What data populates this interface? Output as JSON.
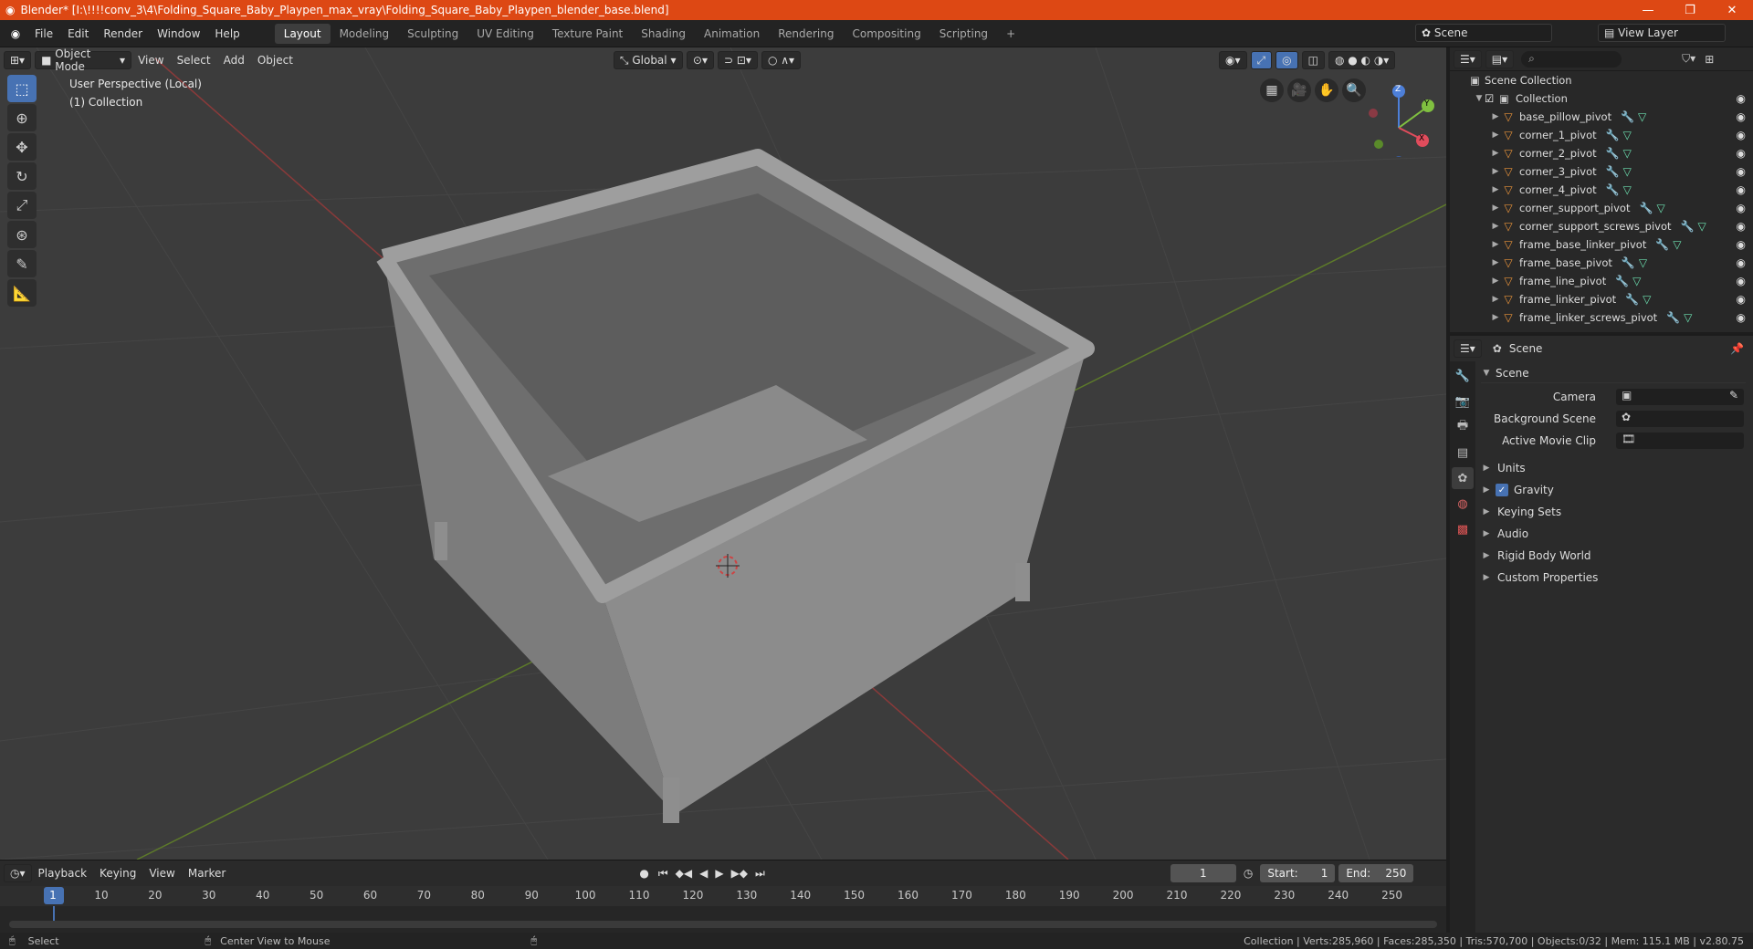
{
  "window": {
    "title": "Blender* [I:\\!!!!conv_3\\4\\Folding_Square_Baby_Playpen_max_vray\\Folding_Square_Baby_Playpen_blender_base.blend]",
    "minimize": "—",
    "maximize": "❐",
    "close": "✕"
  },
  "menu": [
    "File",
    "Edit",
    "Render",
    "Window",
    "Help"
  ],
  "workspaces": [
    "Layout",
    "Modeling",
    "Sculpting",
    "UV Editing",
    "Texture Paint",
    "Shading",
    "Animation",
    "Rendering",
    "Compositing",
    "Scripting"
  ],
  "workspace_add": "+",
  "scene_name": "Scene",
  "view_layer": "View Layer",
  "viewport": {
    "mode": "Object Mode",
    "menus": [
      "View",
      "Select",
      "Add",
      "Object"
    ],
    "orientation": "Global",
    "perspective_label": "User Perspective (Local)",
    "collection_label": "(1) Collection",
    "gizmo": {
      "x": "X",
      "y": "Y",
      "z": "Z"
    }
  },
  "timeline": {
    "menus": [
      "Playback",
      "Keying",
      "View",
      "Marker"
    ],
    "current_frame": "1",
    "start_label": "Start:",
    "start": "1",
    "end_label": "End:",
    "end": "250",
    "ticks": [
      "1",
      "10",
      "20",
      "30",
      "40",
      "50",
      "60",
      "70",
      "80",
      "90",
      "100",
      "110",
      "120",
      "130",
      "140",
      "150",
      "160",
      "170",
      "180",
      "190",
      "200",
      "210",
      "220",
      "230",
      "240",
      "250"
    ]
  },
  "status": {
    "select": "Select",
    "center_view": "Center View to Mouse",
    "stats": "Collection | Verts:285,960 | Faces:285,350 | Tris:570,700 | Objects:0/32 | Mem: 115.1 MB | v2.80.75"
  },
  "outliner": {
    "root": "Scene Collection",
    "collection": "Collection",
    "items": [
      "base_pillow_pivot",
      "corner_1_pivot",
      "corner_2_pivot",
      "corner_3_pivot",
      "corner_4_pivot",
      "corner_support_pivot",
      "corner_support_screws_pivot",
      "frame_base_linker_pivot",
      "frame_base_pivot",
      "frame_line_pivot",
      "frame_linker_pivot",
      "frame_linker_screws_pivot"
    ]
  },
  "properties": {
    "context": "Scene",
    "panel": "Scene",
    "camera_label": "Camera",
    "background_label": "Background Scene",
    "movieclip_label": "Active Movie Clip",
    "sections": [
      "Units",
      "Gravity",
      "Keying Sets",
      "Audio",
      "Rigid Body World",
      "Custom Properties"
    ]
  },
  "colors": {
    "accent": "#4772b3",
    "title_bar": "#dd4814",
    "object_icon": "#e8933a"
  }
}
